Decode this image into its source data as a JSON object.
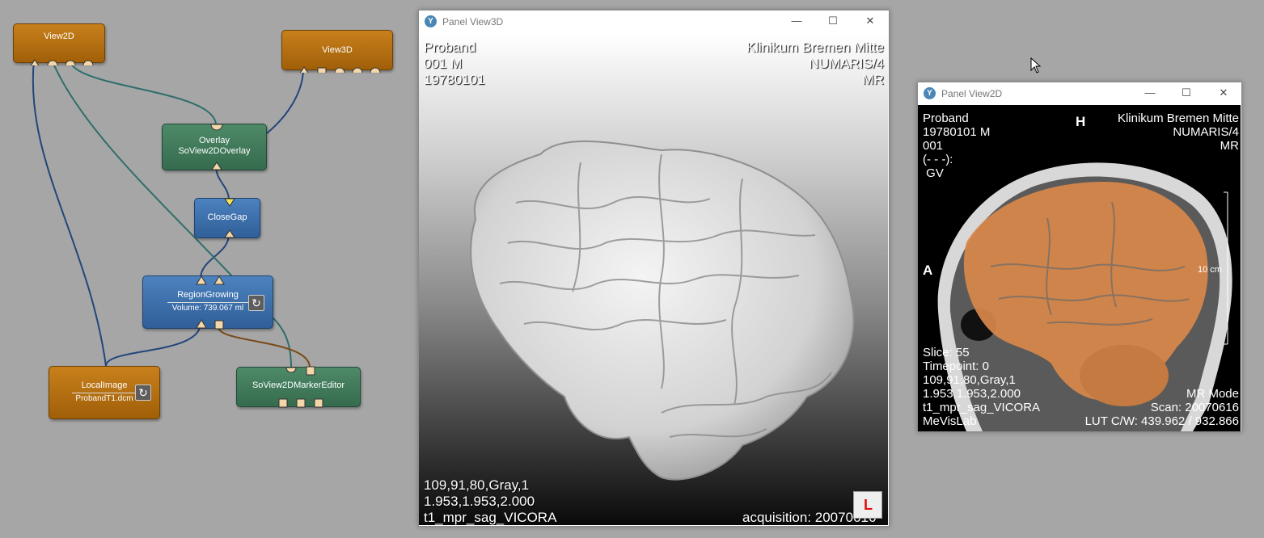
{
  "network": {
    "modules": {
      "view2d": {
        "label": "View2D"
      },
      "view3d": {
        "label": "View3D"
      },
      "overlay": {
        "label": "Overlay",
        "sublabel": "SoView2DOverlay"
      },
      "closegap": {
        "label": "CloseGap"
      },
      "regiongrowing": {
        "label": "RegionGrowing",
        "sublabel": "Volume: 739.067 ml"
      },
      "localimage": {
        "label": "LocalImage",
        "sublabel": "ProbandT1.dcm"
      },
      "markereditor": {
        "label": "SoView2DMarkerEditor"
      }
    },
    "colors": {
      "image_connection": "#23467a",
      "scene_connection": "#2f6e6a",
      "marker_connection": "#7a4a18"
    }
  },
  "panel3d": {
    "title": "Panel View3D",
    "controls": {
      "minimize": "—",
      "maximize": "☐",
      "close": "✕"
    },
    "tl": [
      "Proband",
      "001 M",
      "19780101"
    ],
    "tr": [
      "Klinikum Bremen Mitte",
      "NUMARIS/4",
      "MR"
    ],
    "bl": [
      "109,91,80,Gray,1",
      "1.953,1.953,2.000",
      "t1_mpr_sag_VICORA"
    ],
    "br": "acquisition: 20070616",
    "orientation_marker": "L"
  },
  "panel2d": {
    "title": "Panel View2D",
    "controls": {
      "minimize": "—",
      "maximize": "☐",
      "close": "✕"
    },
    "tl": [
      "Proband",
      "19780101  M",
      "001",
      "(- - -):",
      " GV"
    ],
    "tr": [
      "Klinikum Bremen Mitte",
      "NUMARIS/4",
      "MR"
    ],
    "top_orientation": "H",
    "left_orientation": "A",
    "scale_label": "10 cm",
    "bl": [
      "Slice: 55",
      "Timepoint: 0",
      "109,91,80,Gray,1",
      "1.953,1.953,2.000",
      "t1_mpr_sag_VICORA",
      "MeVisLab"
    ],
    "br": [
      "MR Mode",
      "Scan: 20070616",
      "LUT C/W: 439.962 / 932.866"
    ],
    "overlay_color": "#d9884a"
  }
}
